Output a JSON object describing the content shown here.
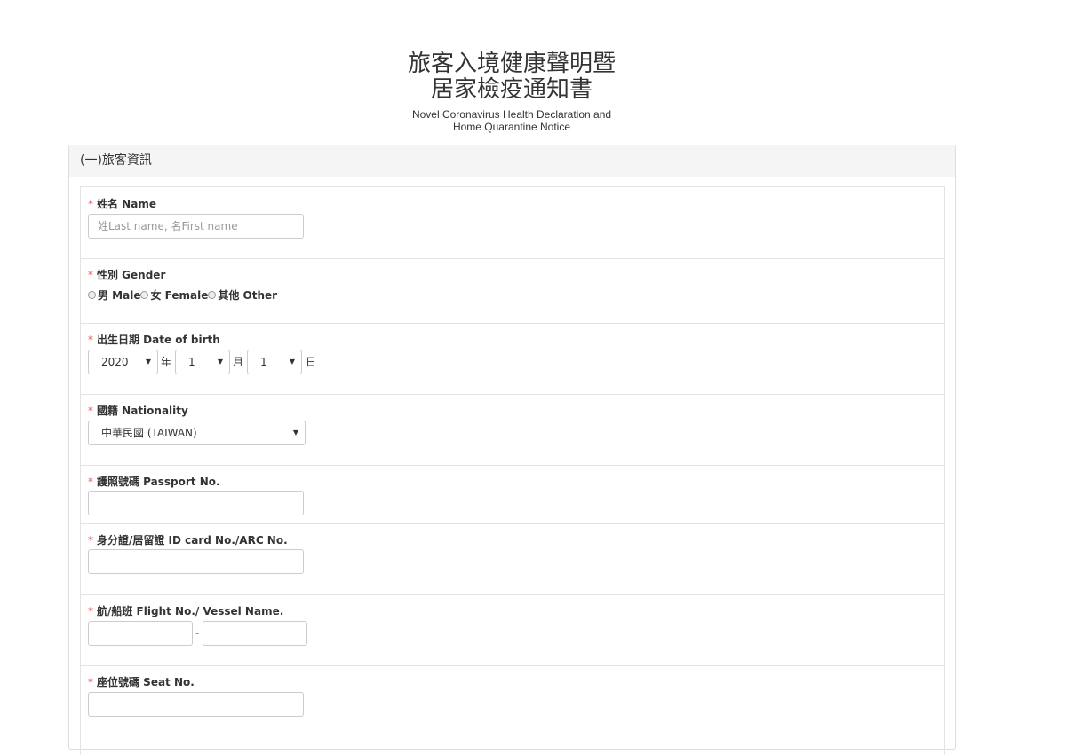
{
  "header": {
    "title_line1": "旅客入境健康聲明暨",
    "title_line2": "居家檢疫通知書",
    "subtitle_line1": "Novel Coronavirus Health Declaration and",
    "subtitle_line2": "Home Quarantine Notice"
  },
  "section": {
    "title": "(一)旅客資訊"
  },
  "required_mark": "*",
  "fields": {
    "name": {
      "label": "姓名 Name",
      "placeholder": "姓Last name, 名First name",
      "value": ""
    },
    "gender": {
      "label": "性別 Gender",
      "options": [
        "男 Male",
        "女 Female",
        "其他 Other"
      ]
    },
    "dob": {
      "label": "出生日期 Date of birth",
      "year": "2020",
      "year_unit": "年",
      "month": "1",
      "month_unit": "月",
      "day": "1",
      "day_unit": "日"
    },
    "nationality": {
      "label": "國籍 Nationality",
      "value": "中華民國 (TAIWAN)"
    },
    "passport": {
      "label": "護照號碼 Passport No.",
      "value": ""
    },
    "idcard": {
      "label": "身分證/居留證 ID card No./ARC No.",
      "value": ""
    },
    "flight": {
      "label": "航/船班 Flight No./ Vessel Name.",
      "separator": "-",
      "value1": "",
      "value2": ""
    },
    "seat": {
      "label": "座位號碼 Seat No.",
      "value": ""
    }
  },
  "icons": {
    "caret": "▼"
  }
}
